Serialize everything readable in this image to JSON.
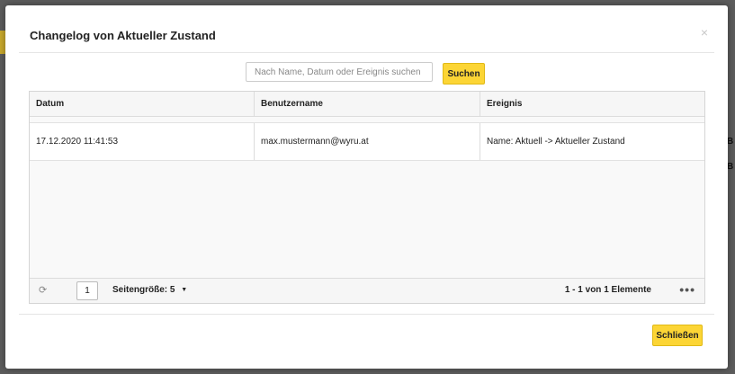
{
  "dialog": {
    "title": "Changelog von Aktueller Zustand",
    "close_icon": "close-icon",
    "close_glyph": "×"
  },
  "search": {
    "placeholder": "Nach Name, Datum oder Ereignis suchen",
    "value": "",
    "button_label": "Suchen"
  },
  "grid": {
    "columns": [
      "Datum",
      "Benutzername",
      "Ereignis"
    ],
    "rows": [
      [
        "17.12.2020 11:41:53",
        "max.mustermann@wyru.at",
        "Name: Aktuell -> Aktueller Zustand"
      ]
    ]
  },
  "pager": {
    "refresh_icon": "refresh-icon",
    "refresh_glyph": "⟳",
    "current_page": "1",
    "page_size_label": "Seitengröße:",
    "page_size_value": "5",
    "page_size_caret": "▼",
    "range_text": "1 - 1 von 1 Elemente",
    "more_icon": "more-icon",
    "more_glyph": "•••"
  },
  "footer": {
    "close_button_label": "Schließen"
  },
  "colors": {
    "accent": "#fcd535",
    "overlay": "#5c5c5c"
  }
}
